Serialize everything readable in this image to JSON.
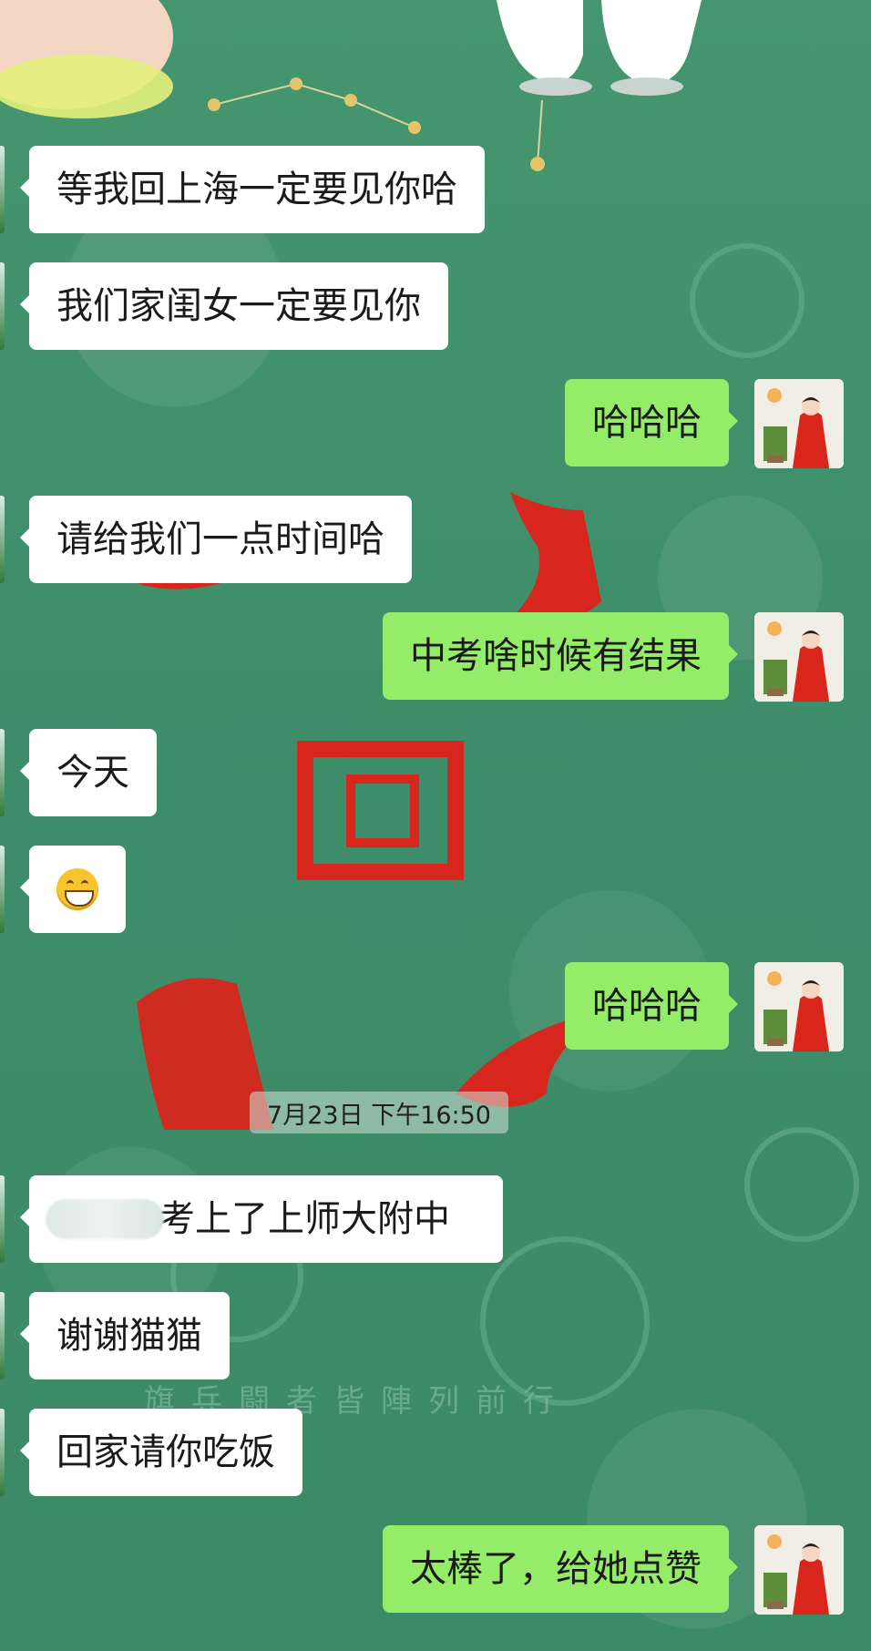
{
  "chat": {
    "messages": [
      {
        "side": "in",
        "text": "等我回上海一定要见你哈"
      },
      {
        "side": "in",
        "text": "我们家闺女一定要见你"
      },
      {
        "side": "out",
        "text": "哈哈哈"
      },
      {
        "side": "in",
        "text": "请给我们一点时间哈"
      },
      {
        "side": "out",
        "text": "中考啥时候有结果"
      },
      {
        "side": "in",
        "text": "今天"
      },
      {
        "side": "in",
        "emoji": "grinning-face-icon"
      },
      {
        "side": "out",
        "text": "哈哈哈"
      },
      {
        "side": "in",
        "text": "考上了上师大附中",
        "redacted_prefix": true
      },
      {
        "side": "in",
        "text": "谢谢猫猫"
      },
      {
        "side": "in",
        "text": "回家请你吃饭"
      },
      {
        "side": "out",
        "text": "太棒了，给她点赞"
      }
    ],
    "timestamp": "7月23日  下午16:50"
  },
  "colors": {
    "background": "#3f8f6c",
    "incoming_bubble": "#ffffff",
    "outgoing_bubble": "#95ec69",
    "ornament_red": "#d7261e"
  },
  "background_art": {
    "caption": "旗兵闘者皆陣列前行"
  }
}
